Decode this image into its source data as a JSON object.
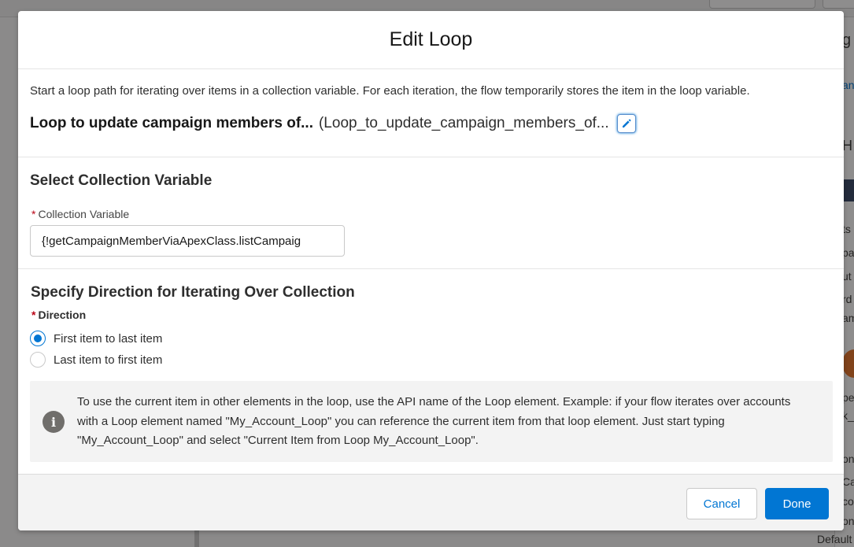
{
  "background": {
    "right_panel_fragments": [
      "g",
      "an",
      "H",
      "ts",
      "pa",
      "ut",
      "rd",
      "am",
      "pe",
      "k_",
      "on",
      "Ca",
      "co",
      "on",
      "Default"
    ]
  },
  "modal": {
    "title": "Edit Loop",
    "intro": "Start a loop path for iterating over items in a collection variable. For each iteration, the flow temporarily stores the item in the loop variable.",
    "loop_label": "Loop to update campaign members of...",
    "loop_api_name": "(Loop_to_update_campaign_members_of...",
    "edit_icon": "pencil-icon"
  },
  "collection_section": {
    "title": "Select Collection Variable",
    "required_marker": "*",
    "field_label": "Collection Variable",
    "field_value": "{!getCampaignMemberViaApexClass.listCampaig"
  },
  "direction_section": {
    "title": "Specify Direction for Iterating Over Collection",
    "required_marker": "*",
    "label": "Direction",
    "options": [
      {
        "label": "First item to last item",
        "selected": true
      },
      {
        "label": "Last item to first item",
        "selected": false
      }
    ]
  },
  "info": {
    "icon": "info-icon",
    "text": "To use the current item in other elements in the loop, use the API name of the Loop element. Example: if your flow iterates over accounts with a Loop element named \"My_Account_Loop\" you can reference the current item from that loop element. Just start typing \"My_Account_Loop\" and select \"Current Item from Loop My_Account_Loop\"."
  },
  "footer": {
    "cancel_label": "Cancel",
    "done_label": "Done"
  },
  "colors": {
    "brand": "#0176d3",
    "required": "#ba0517",
    "info_icon": "#706e6b"
  }
}
